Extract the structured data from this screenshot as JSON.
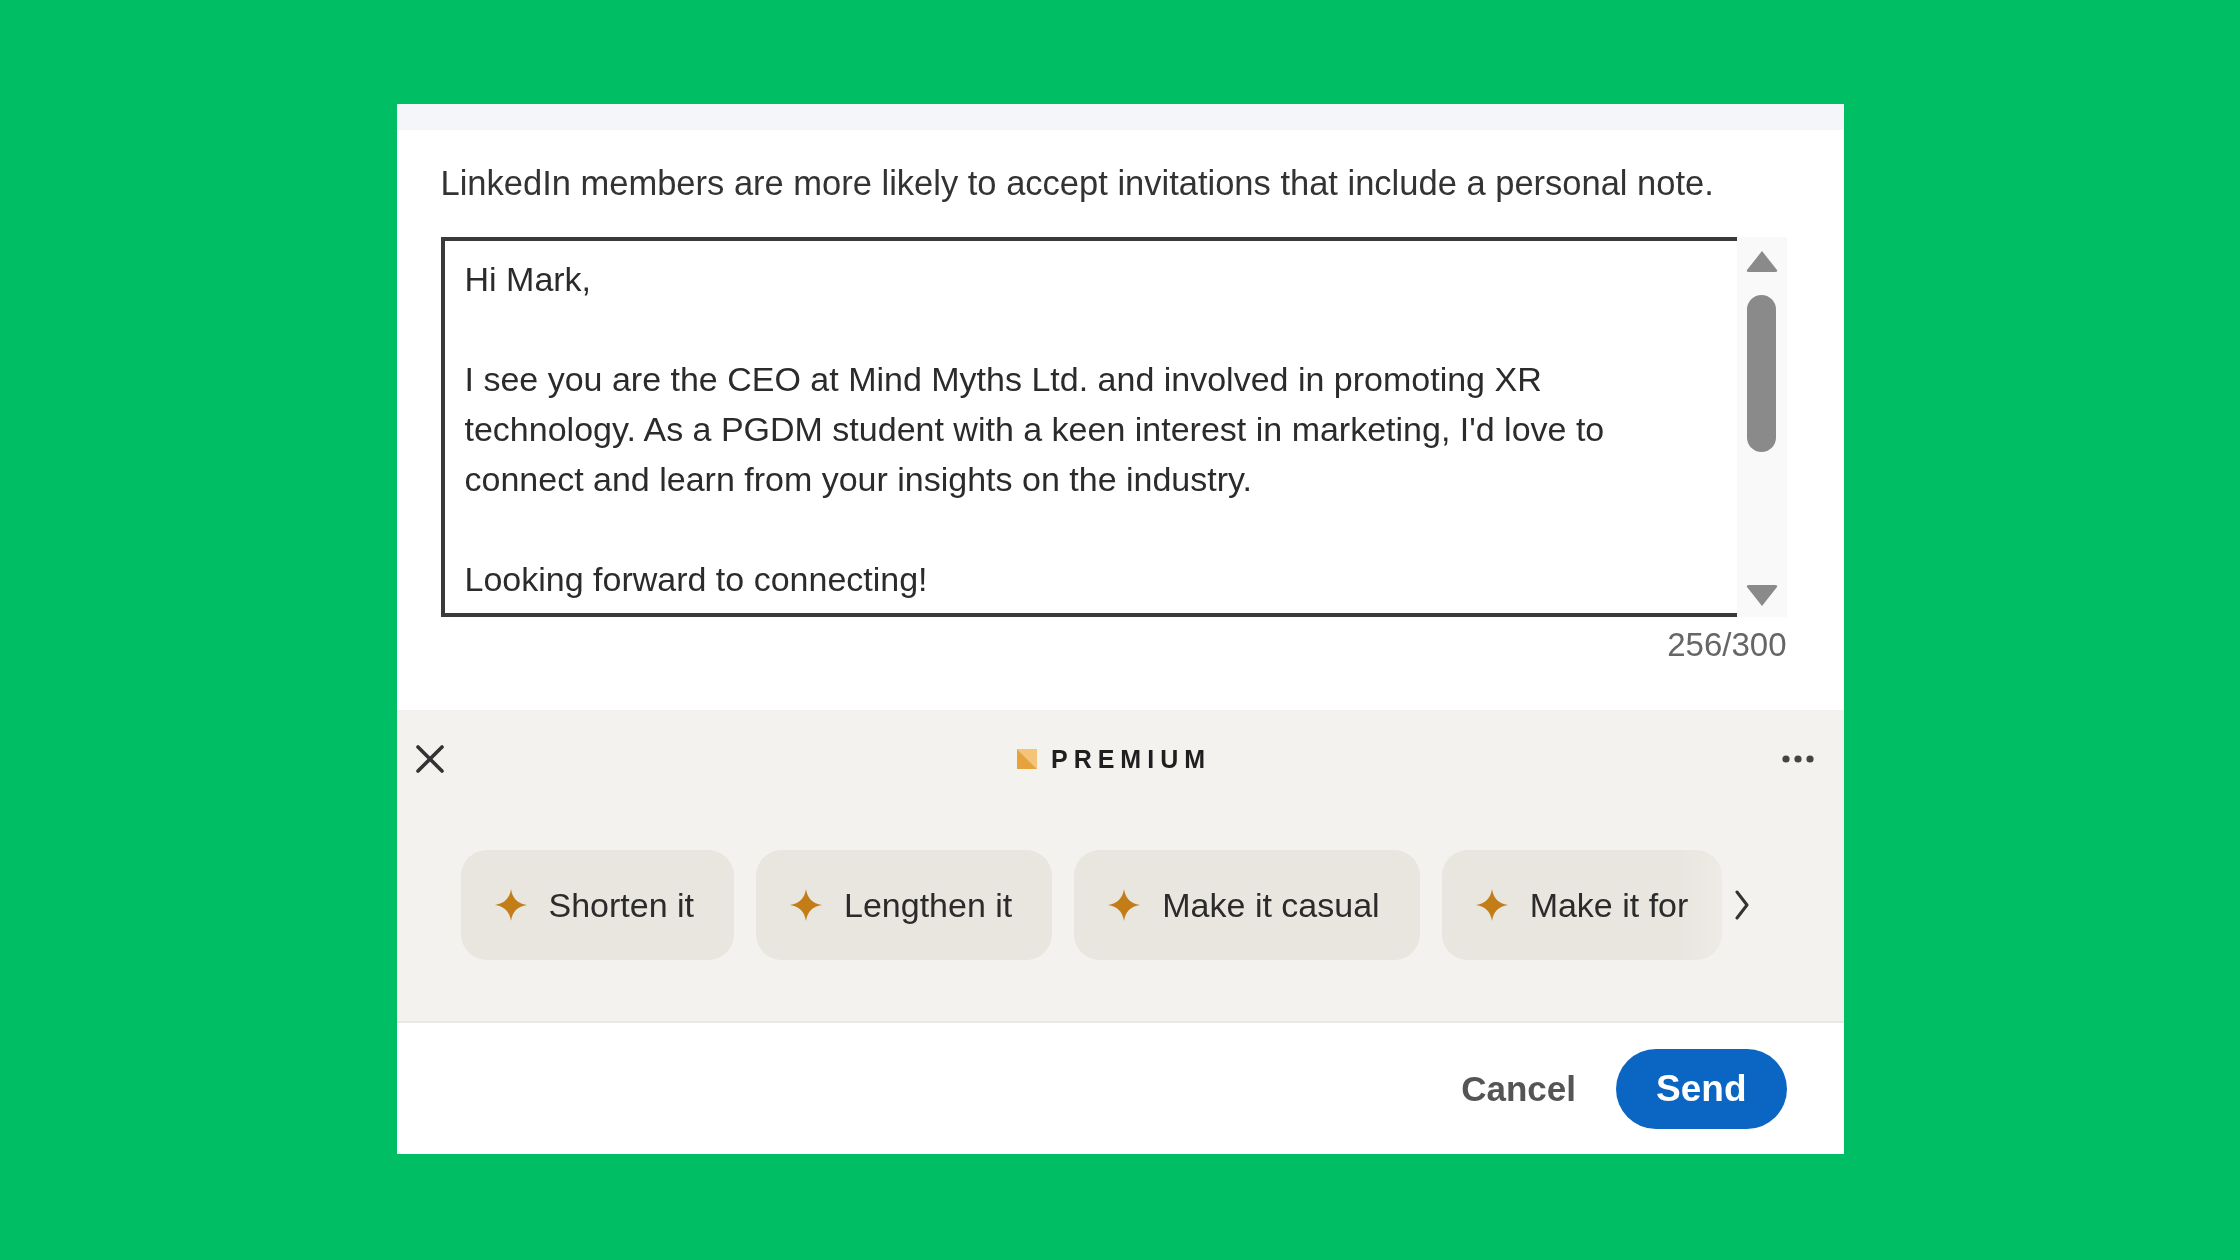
{
  "note": {
    "hint": "LinkedIn members are more likely to accept invitations that include a personal note.",
    "message": "Hi Mark,\n\nI see you are the CEO at Mind Myths Ltd. and involved in promoting XR technology. As a PGDM student with a keen interest in marketing, I'd love to connect and learn from your insights on the industry.\n\nLooking forward to connecting!",
    "counter": "256/300"
  },
  "premium": {
    "label": "PREMIUM",
    "suggestions": [
      {
        "label": "Shorten it",
        "truncated": false
      },
      {
        "label": "Lengthen it",
        "truncated": false
      },
      {
        "label": "Make it casual",
        "truncated": false
      },
      {
        "label": "Make it for",
        "truncated": true
      }
    ]
  },
  "buttons": [
    {
      "label": "Cancel",
      "kind": "text"
    },
    {
      "label": "Send",
      "kind": "primary"
    }
  ]
}
